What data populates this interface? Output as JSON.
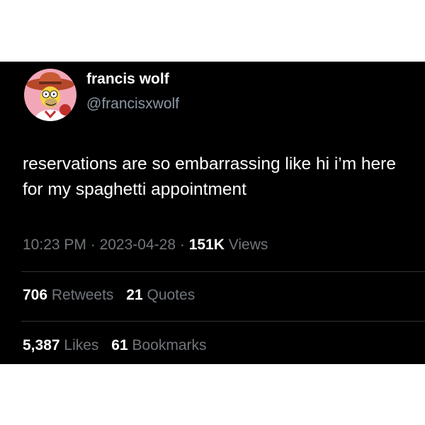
{
  "author": {
    "name": "francis wolf",
    "handle": "@francisxwolf"
  },
  "tweet": {
    "text": "reservations are so embarrassing like hi i’m here for my spaghetti appointment"
  },
  "meta": {
    "time": "10:23 PM",
    "separator": "·",
    "date": "2023-04-28",
    "views_count": "151K",
    "views_label": "Views"
  },
  "stats": {
    "retweets_count": "706",
    "retweets_label": "Retweets",
    "quotes_count": "21",
    "quotes_label": "Quotes",
    "likes_count": "5,387",
    "likes_label": "Likes",
    "bookmarks_count": "61",
    "bookmarks_label": "Bookmarks"
  },
  "colors": {
    "background": "#000000",
    "text_primary": "#ffffff",
    "text_secondary": "#71767b",
    "divider": "#2f3336"
  }
}
